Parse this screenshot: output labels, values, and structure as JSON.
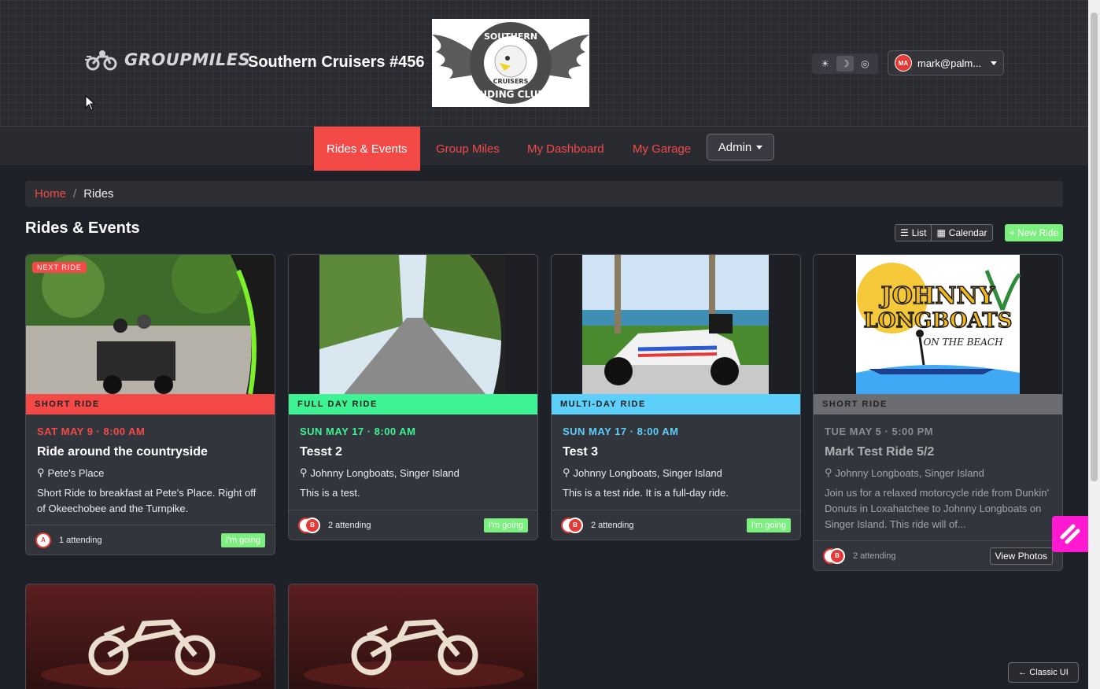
{
  "header": {
    "brand": "GROUPMILES",
    "club_name": "Southern Cruisers #456",
    "logo_text": "SOUTHERN CRUISERS RIDING CLUB",
    "theme_icons": [
      "sun-icon",
      "moon-icon",
      "auto-icon"
    ],
    "user": {
      "initials": "MA",
      "email": "mark@palm..."
    }
  },
  "nav": {
    "items": [
      "Rides & Events",
      "Group Miles",
      "My Dashboard",
      "My Garage"
    ],
    "admin": "Admin"
  },
  "breadcrumb": {
    "home": "Home",
    "sep": "/",
    "current": "Rides"
  },
  "page": {
    "title": "Rides & Events",
    "view_list": "List",
    "view_calendar": "Calendar",
    "new_ride": "+ New Ride"
  },
  "cards": [
    {
      "badge": "NEXT RIDE",
      "type": "SHORT RIDE",
      "type_color": "#f34a48",
      "when": "SAT MAY 9 · 8:00 AM",
      "title": "Ride around the countryside",
      "location": "Pete's Place",
      "desc": "Short Ride to breakfast at Pete's Place. Right off of Okeechobee and the Turnpike.",
      "attending": "1 attending",
      "action": "I'm going",
      "attendees": [
        "A"
      ]
    },
    {
      "type": "FULL DAY RIDE",
      "type_color": "#3ef394",
      "when": "SUN MAY 17 · 8:00 AM",
      "title": "Tesst 2",
      "location": "Johnny Longboats, Singer Island",
      "desc": "This is a test.",
      "attending": "2 attending",
      "action": "I'm going",
      "attendees": [
        "",
        "B"
      ]
    },
    {
      "type": "MULTI-DAY RIDE",
      "type_color": "#5ccffb",
      "when": "SUN MAY 17 · 8:00 AM",
      "title": "Test 3",
      "location": "Johnny Longboats, Singer Island",
      "desc": "This is a test ride. It is a full-day ride.",
      "attending": "2 attending",
      "action": "I'm going",
      "attendees": [
        "",
        "B"
      ]
    },
    {
      "type": "SHORT RIDE",
      "type_color": "#6b6d73",
      "when": "TUE MAY 5 · 5:00 PM",
      "title": "Mark Test Ride 5/2",
      "location": "Johnny Longboats, Singer Island",
      "desc": "Join us for a relaxed motorcycle ride from Dunkin' Donuts in Loxahatchee to Johnny Longboats on Singer Island. This ride will of...",
      "attending": "2 attending",
      "action": "View Photos",
      "attendees": [
        "",
        "B"
      ],
      "logo_line1": "JOHNNY",
      "logo_line2": "LONGBOATS",
      "logo_line3": "ON THE BEACH"
    }
  ],
  "footer": {
    "classic": "← Classic UI"
  }
}
